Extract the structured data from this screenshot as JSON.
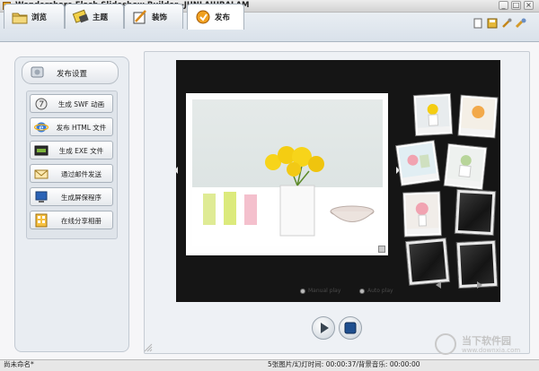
{
  "app": {
    "title": "Wondershare Flash Slideshow Builder -JUNLAJUBALAM"
  },
  "window_controls": {
    "minimize": "_",
    "maximize": "□",
    "close": "×"
  },
  "tabs": [
    {
      "label": "浏览",
      "icon": "folder-icon",
      "active": false
    },
    {
      "label": "主题",
      "icon": "theme-icon",
      "active": false
    },
    {
      "label": "装饰",
      "icon": "decorate-icon",
      "active": false
    },
    {
      "label": "发布",
      "icon": "publish-icon",
      "active": true
    }
  ],
  "toolbar_icons": [
    "new-doc-icon",
    "save-icon",
    "settings-icon",
    "help-icon"
  ],
  "publish_panel": {
    "header": "发布设置",
    "actions": [
      {
        "label": "生成 SWF 动画",
        "icon": "swf-icon"
      },
      {
        "label": "发布 HTML 文件",
        "icon": "ie-icon"
      },
      {
        "label": "生成 EXE 文件",
        "icon": "exe-icon"
      },
      {
        "label": "通过邮件发送",
        "icon": "email-icon"
      },
      {
        "label": "生成屏保程序",
        "icon": "screensaver-icon"
      },
      {
        "label": "在线分享相册",
        "icon": "share-album-icon"
      }
    ]
  },
  "preview": {
    "radio_options": [
      "Manual play",
      "Auto play"
    ],
    "controls": [
      "play-icon",
      "stop-icon"
    ]
  },
  "status": {
    "left": "尚未命名*",
    "center": "5张图片/幻灯时间: 00:00:37/背景音乐: 00:00:00"
  },
  "watermark": {
    "text": "当下软件园",
    "url": "www.downxia.com"
  }
}
